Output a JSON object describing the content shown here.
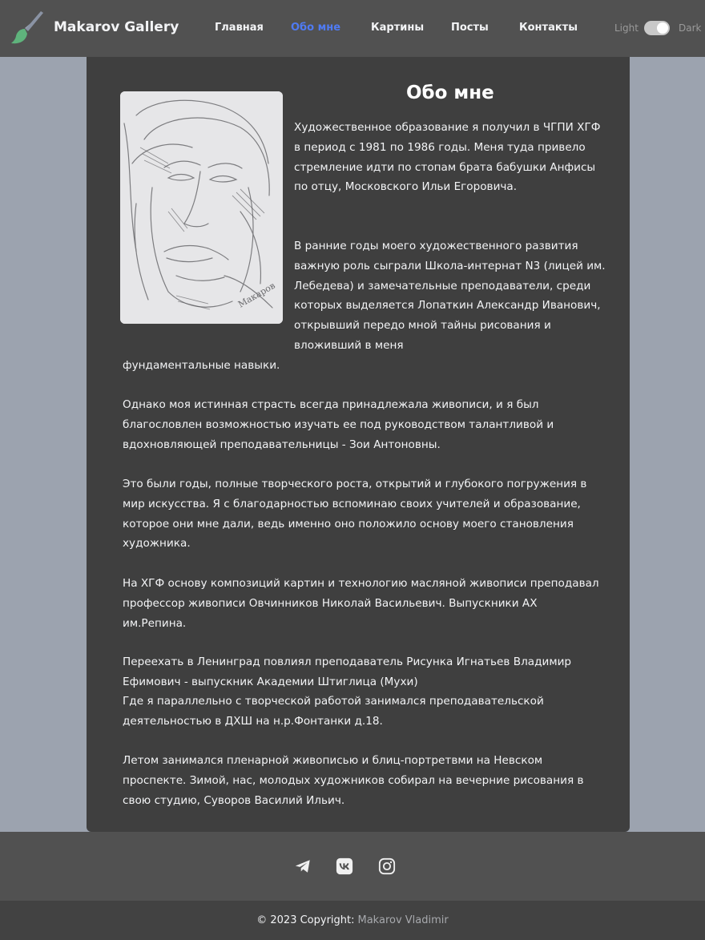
{
  "header": {
    "brand_icon": "paintbrush-icon",
    "brand_title": "Makarov Gallery",
    "nav": [
      {
        "label": "Главная"
      },
      {
        "label": "Обо мне",
        "active": true
      },
      {
        "label": "Картины"
      },
      {
        "label": "Посты"
      },
      {
        "label": "Контакты"
      }
    ],
    "theme_light_label": "Light",
    "theme_dark_label": "Dark",
    "theme_toggle_on": true
  },
  "main": {
    "title": "Обо мне",
    "portrait_icon": "pencil-portrait-sketch",
    "paragraphs": [
      "Художественное образование я получил в ЧГПИ ХГФ в период с 1981 по 1986 годы. Меня туда привело стремление идти по стопам брата бабушки Анфисы по отцу, Московского Ильи Егоровича.",
      "В ранние годы моего художественного развития важную роль сыграли Школа-интернат N3 (лицей им. Лебедева) и замечательные преподаватели, среди которых выделяется Лопаткин Александр Иванович, открывший передо мной тайны рисования и вложивший в меня",
      "фундаментальные навыки.",
      "Однако моя истинная страсть всегда принадлежала живописи, и я был благословлен возможностью изучать ее под руководством талантливой и вдохновляющей преподавательницы - Зои Антоновны.",
      "Это были годы, полные творческого роста, открытий и глубокого погружения в мир искусства. Я с благодарностью вспоминаю своих учителей и образование, которое они мне дали, ведь именно оно положило основу моего становления художника.",
      "На ХГФ основу композиций картин и технологию масляной живописи преподавал профессор живописи Овчинников Николай Васильевич. Выпускники АХ им.Репина.",
      "Переехать в Ленинград повлиял преподаватель Рисунка Игнатьев Владимир Ефимович - выпускник Академии Штиглица (Мухи)",
      "Где я параллельно с творческой работой занимался преподавательской деятельностью в ДХШ на н.р.Фонтанки д.18.",
      "Летом занимался пленарной живописью и блиц-портретвми на Невском проспекте. Зимой, нас, молодых художников собирал на вечерние рисования в свою студию, Суворов Василий Ильич."
    ]
  },
  "footer": {
    "social": [
      {
        "icon": "telegram-icon"
      },
      {
        "icon": "vk-icon"
      },
      {
        "icon": "instagram-icon"
      }
    ],
    "copyright": "© 2023 Copyright:",
    "author": "Makarov Vladimir"
  },
  "colors": {
    "page_bg": "#9ca3af",
    "header_bg": "#515151",
    "card_bg": "#3f3f3f",
    "active_nav": "#4f7bf3",
    "footer_bottom_bg": "#424242"
  }
}
